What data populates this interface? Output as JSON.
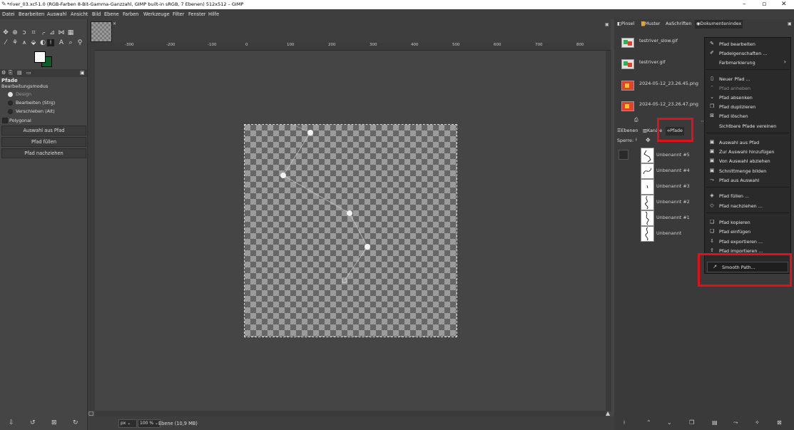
{
  "window": {
    "title": "*river_03.xcf-1.0 (RGB-Farben 8-Bit-Gamma-Ganzzahl, GIMP built-in sRGB, 7 Ebenen) 512x512 – GIMP",
    "minimize": "–",
    "restore": "▫",
    "close": "✕"
  },
  "menubar": [
    "Datei",
    "Bearbeiten",
    "Auswahl",
    "Ansicht",
    "Bild",
    "Ebene",
    "Farben",
    "Werkzeuge",
    "Filter",
    "Fenster",
    "Hilfe"
  ],
  "tool_options": {
    "section_title": "Pfade",
    "mode_label": "Bearbeitungsmodus",
    "modes": [
      "Design",
      "Bearbeiten (Strg)",
      "Verschieben (Alt)"
    ],
    "polygonal": "Polygonal",
    "buttons": [
      "Auswahl aus Pfad",
      "Pfad füllen",
      "Pfad nachziehen"
    ]
  },
  "ruler_marks": [
    "-300",
    "-200",
    "-100",
    "0",
    "100",
    "200",
    "300",
    "400",
    "500",
    "600",
    "700",
    "800"
  ],
  "statusbar": {
    "unit": "px",
    "zoom": "100 %",
    "info": "Ebene (10,9 MB)"
  },
  "dock": {
    "tabs": [
      "Pinsel",
      "Muster",
      "Schriften",
      "Dokumentenindex"
    ],
    "documents": [
      {
        "name": "testriver_slow.gif"
      },
      {
        "name": "testriver.gif"
      },
      {
        "name": "2024-05-12_23.26.45.png"
      },
      {
        "name": "2024-05-12_23.26.47.png"
      }
    ],
    "layer_tabs": [
      "Ebenen",
      "Kanäle",
      "Pfade"
    ],
    "lock_label": "Sperre:",
    "paths": [
      "Unbenannt #5",
      "Unbenannt #4",
      "Unbenannt #3",
      "Unbenannt #2",
      "Unbenannt #1",
      "Unbenannt"
    ]
  },
  "context_menu": {
    "groups": [
      [
        {
          "icon": "edit-path-icon",
          "glyph": "✎",
          "label": "Pfad bearbeiten"
        },
        {
          "icon": "path-properties-icon",
          "glyph": "✐",
          "label": "Pfadeigenschaften ..."
        },
        {
          "icon": "",
          "glyph": "",
          "label": "Farbmarkierung",
          "submenu": "›"
        }
      ],
      [
        {
          "icon": "new-path-icon",
          "glyph": "▯",
          "label": "Neuer Pfad ..."
        },
        {
          "icon": "raise-path-icon",
          "glyph": "⌃",
          "label": "Pfad anheben",
          "disabled": true
        },
        {
          "icon": "lower-path-icon",
          "glyph": "⌄",
          "label": "Pfad absenken"
        },
        {
          "icon": "duplicate-path-icon",
          "glyph": "❐",
          "label": "Pfad duplizieren"
        },
        {
          "icon": "delete-path-icon",
          "glyph": "⊠",
          "label": "Pfad löschen"
        },
        {
          "icon": "",
          "glyph": "",
          "label": "Sichtbare Pfade vereinen"
        }
      ],
      [
        {
          "icon": "selection-from-path-icon",
          "glyph": "▣",
          "label": "Auswahl aus Pfad"
        },
        {
          "icon": "add-to-selection-icon",
          "glyph": "▣",
          "label": "Zur Auswahl hinzufügen"
        },
        {
          "icon": "subtract-from-selection-icon",
          "glyph": "▣",
          "label": "Von Auswahl abziehen"
        },
        {
          "icon": "intersect-selection-icon",
          "glyph": "▣",
          "label": "Schnittmenge bilden"
        },
        {
          "icon": "path-to-selection-icon",
          "glyph": "⤳",
          "label": "Pfad aus Auswahl"
        }
      ],
      [
        {
          "icon": "fill-path-icon",
          "glyph": "◈",
          "label": "Pfad füllen ..."
        },
        {
          "icon": "stroke-path-icon",
          "glyph": "◇",
          "label": "Pfad nachziehen ..."
        }
      ],
      [
        {
          "icon": "copy-path-icon",
          "glyph": "❏",
          "label": "Pfad kopieren"
        },
        {
          "icon": "paste-path-icon",
          "glyph": "❏",
          "label": "Pfad einfügen"
        },
        {
          "icon": "export-path-icon",
          "glyph": "⇩",
          "label": "Pfad exportieren ..."
        },
        {
          "icon": "import-path-icon",
          "glyph": "⇧",
          "label": "Pfad importieren ..."
        }
      ],
      [
        {
          "icon": "smooth-path-icon",
          "glyph": "↗",
          "label": "Smooth Path..."
        }
      ]
    ]
  },
  "colors": {
    "foreground": "#ffffff",
    "background": "#0e5c2a",
    "highlight": "#e3101a"
  }
}
